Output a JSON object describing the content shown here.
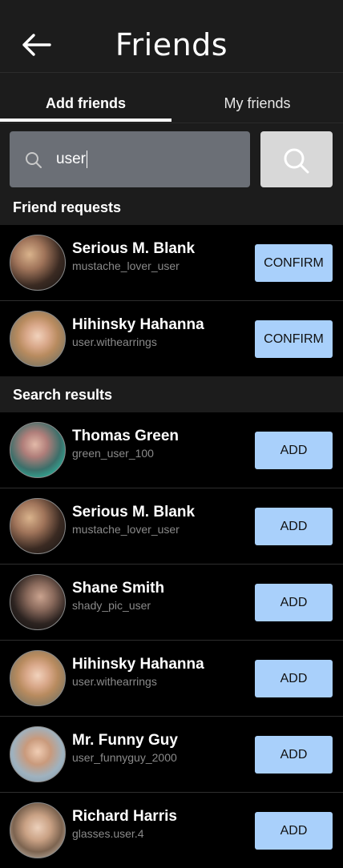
{
  "header": {
    "title": "Friends",
    "back_icon": "arrow-left-icon"
  },
  "tabs": [
    {
      "label": "Add friends",
      "active": true
    },
    {
      "label": "My friends",
      "active": false
    }
  ],
  "search": {
    "value": "user",
    "placeholder": "",
    "icon": "search-icon",
    "button_icon": "search-icon"
  },
  "requests": {
    "title": "Friend requests",
    "items": [
      {
        "name": "Serious M. Blank",
        "handle": "mustache_lover_user",
        "action": "CONFIRM"
      },
      {
        "name": "Hihinsky Hahanna",
        "handle": "user.withearrings",
        "action": "CONFIRM"
      }
    ]
  },
  "results": {
    "title": "Search results",
    "items": [
      {
        "name": "Thomas Green",
        "handle": "green_user_100",
        "action": "ADD"
      },
      {
        "name": "Serious M. Blank",
        "handle": "mustache_lover_user",
        "action": "ADD"
      },
      {
        "name": "Shane Smith",
        "handle": "shady_pic_user",
        "action": "ADD"
      },
      {
        "name": "Hihinsky Hahanna",
        "handle": "user.withearrings",
        "action": "ADD"
      },
      {
        "name": "Mr. Funny Guy",
        "handle": "user_funnyguy_2000",
        "action": "ADD"
      },
      {
        "name": "Richard Harris",
        "handle": "glasses.user.4",
        "action": "ADD"
      }
    ]
  },
  "colors": {
    "background": "#1c1c1c",
    "list_background": "#000000",
    "action_button": "#a9d0fb",
    "search_field": "#6b6f76",
    "search_button": "#d8d8d8"
  }
}
